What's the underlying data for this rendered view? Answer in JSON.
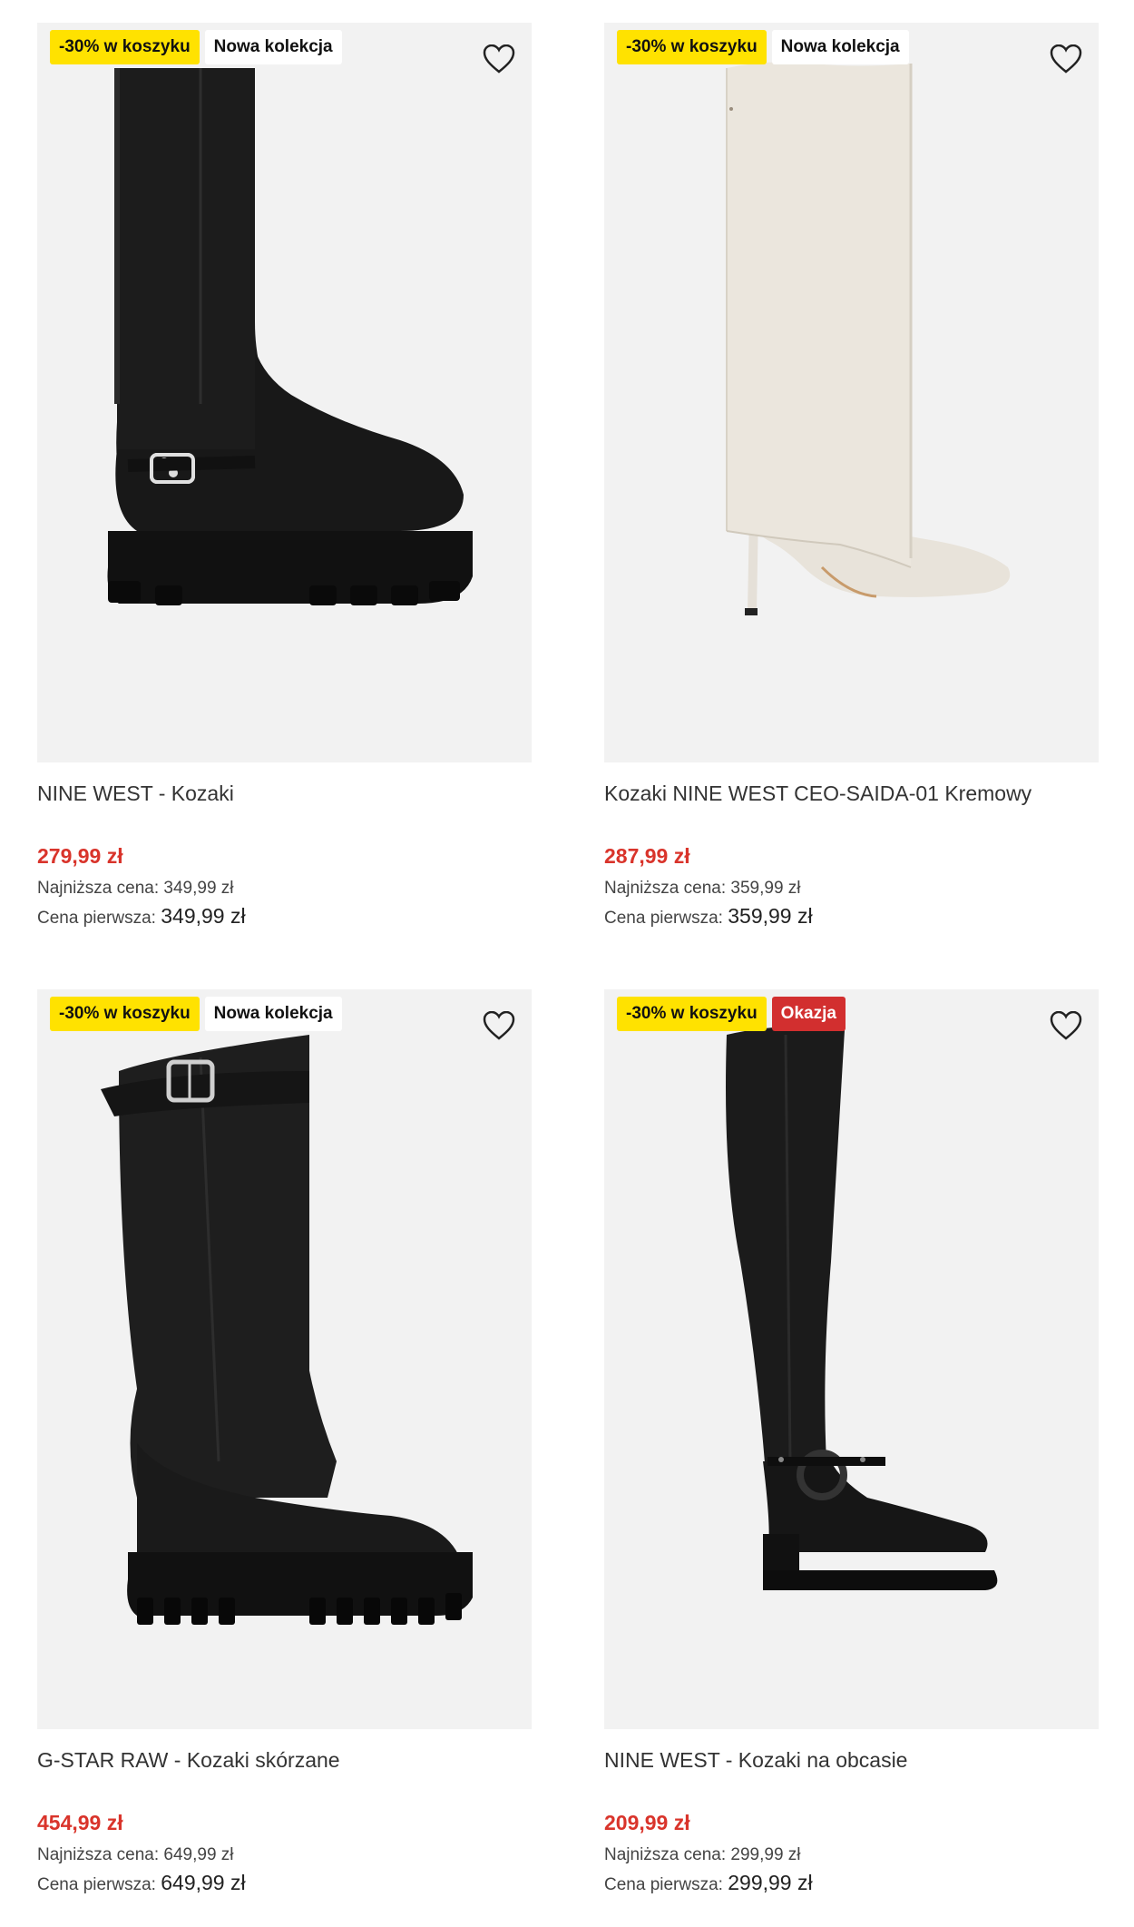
{
  "products": [
    {
      "badges": [
        "-30% w koszyku",
        "Nowa kolekcja"
      ],
      "title": "NINE WEST - Kozaki",
      "price": "279,99 zł",
      "lowest_label": "Najniższa cena:",
      "lowest_value": "349,99 zł",
      "first_label": "Cena pierwsza:",
      "first_value": "349,99 zł",
      "image": "black-knee-boot-chunky-sole"
    },
    {
      "badges": [
        "-30% w koszyku",
        "Nowa kolekcja"
      ],
      "title": "Kozaki NINE WEST CEO-SAIDA-01 Kremowy",
      "price": "287,99 zł",
      "lowest_label": "Najniższa cena:",
      "lowest_value": "359,99 zł",
      "first_label": "Cena pierwsza:",
      "first_value": "359,99 zł",
      "image": "cream-stiletto-boot"
    },
    {
      "badges": [
        "-30% w koszyku",
        "Nowa kolekcja"
      ],
      "title": "G-STAR RAW - Kozaki skórzane",
      "price": "454,99 zł",
      "lowest_label": "Najniższa cena:",
      "lowest_value": "649,99 zł",
      "first_label": "Cena pierwsza:",
      "first_value": "649,99 zł",
      "image": "black-leather-boot-buckle-strap"
    },
    {
      "badges": [
        "-30% w koszyku",
        "Okazja"
      ],
      "title": "NINE WEST - Kozaki na obcasie",
      "price": "209,99 zł",
      "lowest_label": "Najniższa cena:",
      "lowest_value": "299,99 zł",
      "first_label": "Cena pierwsza:",
      "first_value": "299,99 zł",
      "image": "black-over-knee-boot-harness"
    }
  ],
  "colors": {
    "promo_badge": "#ffe200",
    "deal_badge": "#d22f2f",
    "sale_price": "#d9342b",
    "image_bg": "#f2f2f2"
  },
  "icons": {
    "favorite": "heart-outline-icon"
  }
}
